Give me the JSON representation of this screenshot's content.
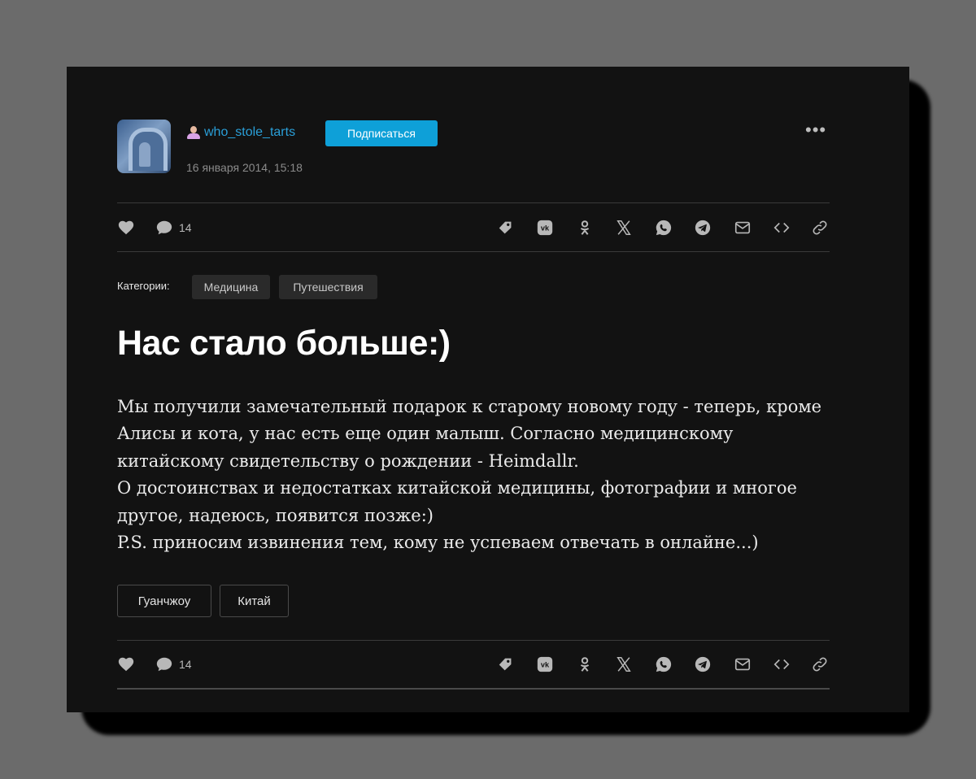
{
  "post": {
    "author": "who_stole_tarts",
    "subscribe_label": "Подписаться",
    "date": "16 января 2014, 15:18",
    "more_label": "•••",
    "comment_count": "14",
    "categories_label": "Категории:",
    "categories": [
      "Медицина",
      "Путешествия"
    ],
    "title": "Нас стало больше:)",
    "body_lines": [
      "Мы получили замечательный подарок к старому новому году - теперь, кроме",
      "Алисы и кота, у нас есть еще один малыш. Согласно медицинскому",
      "китайскому свидетельству о рождении - Heimdallr.",
      "О достоинствах и недостатках китайской медицины, фотографии и многое",
      "другое, надеюсь, появится позже:)",
      "P.S. приносим извинения тем, кому не успеваем отвечать в онлайне...)"
    ],
    "tags": [
      "Гуанчжоу",
      "Китай"
    ]
  },
  "share_icons": [
    "bookmark-icon",
    "vk-icon",
    "odnoklassniki-icon",
    "x-icon",
    "whatsapp-icon",
    "telegram-icon",
    "email-icon",
    "embed-icon",
    "link-icon"
  ],
  "colors": {
    "accent": "#0ea0d8",
    "username": "#2a9fd8",
    "background": "#121212",
    "page": "#6b6b6b"
  }
}
